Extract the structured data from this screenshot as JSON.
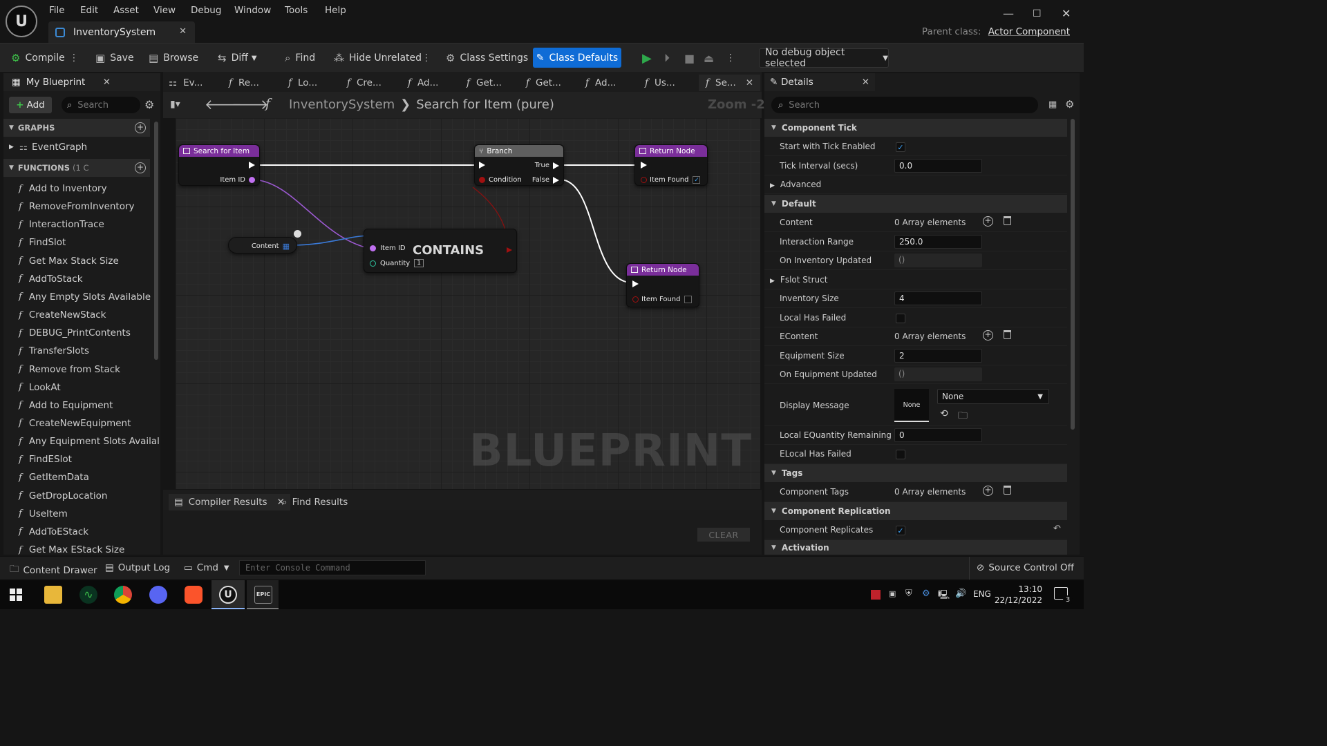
{
  "app": {
    "logo": "U",
    "menu": [
      "File",
      "Edit",
      "Asset",
      "View",
      "Debug",
      "Window",
      "Tools",
      "Help"
    ],
    "document_tab": "InventorySystem",
    "parent_class_label": "Parent class:",
    "parent_class_value": "Actor Component",
    "window_controls": [
      "minimize-icon",
      "maximize-icon",
      "close-icon"
    ]
  },
  "toolbar": {
    "compile": "Compile",
    "save": "Save",
    "browse": "Browse",
    "diff": "Diff",
    "find": "Find",
    "hide_unrelated": "Hide Unrelated",
    "class_settings": "Class Settings",
    "class_defaults": "Class Defaults",
    "debug_object": "No debug object selected"
  },
  "my_blueprint": {
    "tab": "My Blueprint",
    "add": "Add",
    "search_placeholder": "Search",
    "graphs_header": "GRAPHS",
    "event_graph": "EventGraph",
    "functions_header": "FUNCTIONS",
    "functions_count": "(1 C",
    "functions": [
      "Add to Inventory",
      "RemoveFromInventory",
      "InteractionTrace",
      "FindSlot",
      "Get Max Stack Size",
      "AddToStack",
      "Any Empty Slots Available",
      "CreateNewStack",
      "DEBUG_PrintContents",
      "TransferSlots",
      "Remove from Stack",
      "LookAt",
      "Add to Equipment",
      "CreateNewEquipment",
      "Any Equipment Slots Availal",
      "FindESlot",
      "GetItemData",
      "GetDropLocation",
      "UseItem",
      "AddToEStack",
      "Get Max EStack Size"
    ]
  },
  "graph_tabs": [
    "Ev...",
    "Re...",
    "Lo...",
    "Cre...",
    "Ad...",
    "Get...",
    "Get...",
    "Ad...",
    "Us...",
    "Se..."
  ],
  "breadcrumb": {
    "root": "InventorySystem",
    "current": "Search for Item (pure)",
    "zoom": "Zoom -2"
  },
  "graph": {
    "watermark": "BLUEPRINT",
    "nodes": {
      "entry": {
        "title": "Search for Item",
        "pin_item_id": "Item ID"
      },
      "branch": {
        "title": "Branch",
        "condition": "Condition",
        "true": "True",
        "false": "False"
      },
      "return_true": {
        "title": "Return Node",
        "pin": "Item Found",
        "checked": "✓"
      },
      "content": {
        "label": "Content"
      },
      "contains": {
        "title": "CONTAINS",
        "pin_item_id": "Item ID",
        "pin_quantity": "Quantity",
        "quantity_value": "1"
      },
      "return_false": {
        "title": "Return Node",
        "pin": "Item Found"
      }
    }
  },
  "bottom_panel": {
    "compiler_results": "Compiler Results",
    "find_results": "Find Results",
    "clear": "CLEAR"
  },
  "details": {
    "tab": "Details",
    "search_placeholder": "Search",
    "sections": {
      "component_tick": "Component Tick",
      "default": "Default",
      "tags": "Tags",
      "component_replication": "Component Replication",
      "activation": "Activation"
    },
    "rows": {
      "start_with_tick": {
        "label": "Start with Tick Enabled",
        "checked": "✓"
      },
      "tick_interval": {
        "label": "Tick Interval (secs)",
        "value": "0.0"
      },
      "advanced": {
        "label": "Advanced"
      },
      "content": {
        "label": "Content",
        "value": "0 Array elements"
      },
      "interaction_range": {
        "label": "Interaction Range",
        "value": "250.0"
      },
      "on_inventory_updated": {
        "label": "On Inventory Updated",
        "value": "()"
      },
      "fslot_struct": {
        "label": "Fslot Struct"
      },
      "inventory_size": {
        "label": "Inventory Size",
        "value": "4"
      },
      "local_has_failed": {
        "label": "Local Has Failed"
      },
      "econtent": {
        "label": "EContent",
        "value": "0 Array elements"
      },
      "equipment_size": {
        "label": "Equipment Size",
        "value": "2"
      },
      "on_equipment_updated": {
        "label": "On Equipment Updated",
        "value": "()"
      },
      "display_message": {
        "label": "Display Message",
        "thumb": "None",
        "select": "None"
      },
      "local_equantity_remaining": {
        "label": "Local EQuantity Remaining",
        "value": "0"
      },
      "elocal_has_failed": {
        "label": "ELocal Has Failed"
      },
      "component_tags": {
        "label": "Component Tags",
        "value": "0 Array elements"
      },
      "component_replicates": {
        "label": "Component Replicates",
        "checked": "✓"
      }
    }
  },
  "statusbar": {
    "content_drawer": "Content Drawer",
    "output_log": "Output Log",
    "cmd": "Cmd",
    "console_placeholder": "Enter Console Command",
    "source_control": "Source Control Off"
  },
  "taskbar": {
    "language": "ENG",
    "time": "13:10",
    "date": "22/12/2022",
    "notifications": "3"
  },
  "colors": {
    "accent": "#0f6cd6",
    "function_header": "#7a2e9a",
    "branch_header": "#6b6b6b",
    "exec_wire": "#ffffff",
    "data_wire_purple": "#9b59d0",
    "data_wire_blue": "#3a7ad8"
  }
}
